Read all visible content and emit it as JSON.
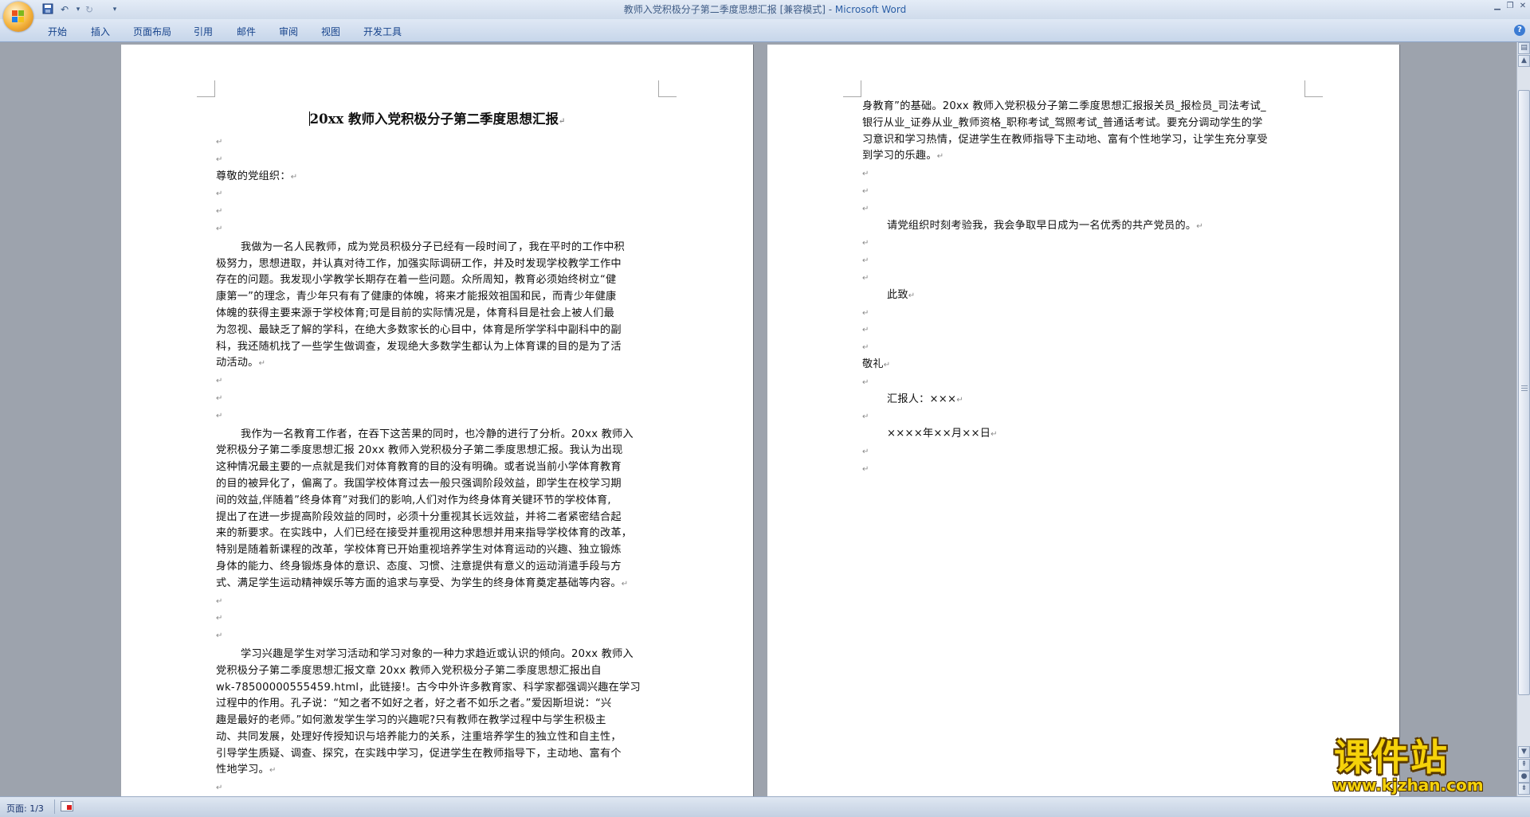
{
  "window": {
    "title": "教师入党积极分子第二季度思想汇报 [兼容模式] - ",
    "app_name": "Microsoft Word"
  },
  "quick_access": {
    "save_icon": "save-icon",
    "undo_icon": "undo-icon",
    "redo_icon": "redo-icon",
    "customize_icon": "dropdown-icon"
  },
  "ribbon": {
    "tabs": [
      "开始",
      "插入",
      "页面布局",
      "引用",
      "邮件",
      "审阅",
      "视图",
      "开发工具"
    ]
  },
  "page1": {
    "heading": "20xx 教师入党积极分子第二季度思想汇报",
    "salutation": "尊敬的党组织：",
    "paragraph1": [
      "我做为一名人民教师，成为党员积极分子已经有一段时间了，我在平时的工作中积",
      "极努力，思想进取，并认真对待工作，加强实际调研工作，并及时发现学校教学工作中",
      "存在的问题。我发现小学教学长期存在着一些问题。众所周知，教育必须始终树立“健",
      "康第一”的理念，青少年只有有了健康的体魄，将来才能报效祖国和民，而青少年健康",
      "体魄的获得主要来源于学校体育;可是目前的实际情况是，体育科目是社会上被人们最",
      "为忽视、最缺乏了解的学科，在绝大多数家长的心目中，体育是所学学科中副科中的副",
      "科，我还随机找了一些学生做调查，发现绝大多数学生都认为上体育课的目的是为了活",
      "动活动。"
    ],
    "paragraph2": [
      "我作为一名教育工作者，在吞下这苦果的同时，也冷静的进行了分析。20xx 教师入",
      "党积极分子第二季度思想汇报 20xx 教师入党积极分子第二季度思想汇报。我认为出现",
      "这种情况最主要的一点就是我们对体育教育的目的没有明确。或者说当前小学体育教育",
      "的目的被异化了，偏离了。我国学校体育过去一般只强调阶段效益，即学生在校学习期",
      "间的效益,伴随着”终身体育”对我们的影响,人们对作为终身体育关键环节的学校体育,",
      "提出了在进一步提高阶段效益的同时，必须十分重视其长远效益，并将二者紧密结合起",
      "来的新要求。在实践中，人们已经在接受并重视用这种思想并用来指导学校体育的改革，",
      "特别是随着新课程的改革，学校体育已开始重视培养学生对体育运动的兴趣、独立锻炼",
      "身体的能力、终身锻炼身体的意识、态度、习惯、注意提供有意义的运动消遣手段与方",
      "式、满足学生运动精神娱乐等方面的追求与享受、为学生的终身体育奠定基础等内容。"
    ],
    "paragraph3": [
      "学习兴趣是学生对学习活动和学习对象的一种力求趋近或认识的倾向。20xx 教师入",
      "党积极分子第二季度思想汇报文章 20xx 教师入党积极分子第二季度思想汇报出自",
      "wk-78500000555459.html，此链接!。古今中外许多教育家、科学家都强调兴趣在学习",
      "过程中的作用。孔子说：“知之者不如好之者，好之者不如乐之者。”爱因斯坦说：“兴",
      "趣是最好的老师。”如何激发学生学习的兴趣呢?只有教师在教学过程中与学生积极主",
      "动、共同发展，处理好传授知识与培养能力的关系，注重培养学生的独立性和自主性，",
      "引导学生质疑、调查、探究，在实践中学习，促进学生在教师指导下，主动地、富有个",
      "性地学习。"
    ]
  },
  "page2": {
    "continuation": [
      "身教育”的基础。20xx 教师入党积极分子第二季度思想汇报报关员_报检员_司法考试_",
      "银行从业_证券从业_教师资格_职称考试_驾照考试_普通话考试。要充分调动学生的学",
      "习意识和学习热情，促进学生在教师指导下主动地、富有个性地学习，让学生充分享受",
      "到学习的乐趣。"
    ],
    "request": "请党组织时刻考验我，我会争取早日成为一名优秀的共产党员的。",
    "closing1": "此致",
    "closing2": "敬礼",
    "reporter": "汇报人：×××",
    "date": "××××年××月××日"
  },
  "para_mark": "↵",
  "status_bar": {
    "page_indicator": "页面: 1/3",
    "proofing_icon": "proofing-icon"
  },
  "watermark": {
    "title": "课件站",
    "url": "www.kjzhan.com"
  }
}
